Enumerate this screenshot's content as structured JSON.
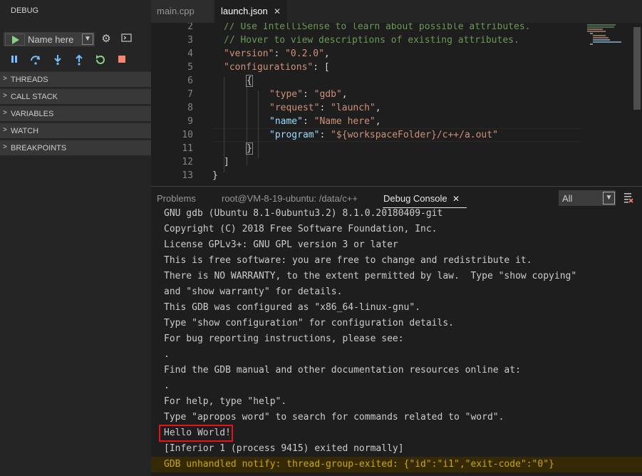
{
  "sidebar": {
    "title": "DEBUG",
    "config_name": "Name here",
    "sections": [
      "THREADS",
      "CALL STACK",
      "VARIABLES",
      "WATCH",
      "BREAKPOINTS"
    ]
  },
  "tabs": [
    {
      "label": "main.cpp",
      "active": false
    },
    {
      "label": "launch.json",
      "active": true
    }
  ],
  "editor": {
    "line_numbers": [
      "2",
      "3",
      "4",
      "5",
      "6",
      "7",
      "8",
      "9",
      "10",
      "11",
      "12",
      "13"
    ],
    "lines": {
      "l2": "// Use IntelliSense to learn about possible attributes.",
      "l3": "// Hover to view descriptions of existing attributes.",
      "l4_key": "\"version\"",
      "l4_val": "\"0.2.0\"",
      "l5_key": "\"configurations\"",
      "l6": "{",
      "l7_key": "\"type\"",
      "l7_val": "\"gdb\"",
      "l8_key": "\"request\"",
      "l8_val": "\"launch\"",
      "l9_key": "\"name\"",
      "l9_val": "\"Name here\"",
      "l10_key": "\"program\"",
      "l10_val": "\"${workspaceFolder}/c++/a.out\"",
      "l11": "}",
      "l12": "]",
      "l13": "}"
    }
  },
  "panel": {
    "tabs": [
      "Problems",
      "root@VM-8-19-ubuntu: /data/c++",
      "Debug Console"
    ],
    "active_tab": "Debug Console",
    "filter_value": "All",
    "console_lines": [
      "GNU gdb (Ubuntu 8.1-0ubuntu3.2) 8.1.0.20180409-git",
      "Copyright (C) 2018 Free Software Foundation, Inc.",
      "License GPLv3+: GNU GPL version 3 or later",
      "This is free software: you are free to change and redistribute it.",
      "There is NO WARRANTY, to the extent permitted by law.  Type \"show copying\"",
      "and \"show warranty\" for details.",
      "This GDB was configured as \"x86_64-linux-gnu\".",
      "Type \"show configuration\" for configuration details.",
      "For bug reporting instructions, please see:",
      ".",
      "Find the GDB manual and other documentation resources online at:",
      ".",
      "For help, type \"help\".",
      "Type \"apropos word\" to search for commands related to \"word\".",
      "Hello World!",
      "[Inferior 1 (process 9415) exited normally]",
      "GDB unhandled notify: thread-group-exited: {\"id\":\"i1\",\"exit-code\":\"0\"}"
    ]
  },
  "colors": {
    "accent_green": "#89d185",
    "highlight_box": "#e8121b",
    "warning_text": "#cca700"
  }
}
